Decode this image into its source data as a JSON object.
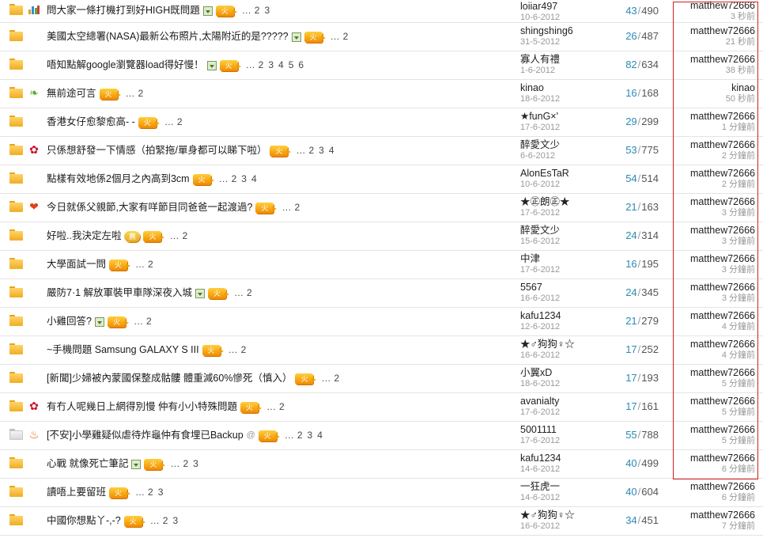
{
  "rows": [
    {
      "folder": "yellow",
      "emo": "chart-icon",
      "title": "問大家一條打機打到好HIGH既問題",
      "img": true,
      "clip": false,
      "badges": [
        "火"
      ],
      "pages": [
        "2",
        "3"
      ],
      "author": "loiiar497",
      "date": "10-6-2012",
      "replies": "43",
      "views": "490",
      "last_user": "matthew72666",
      "last_time": "3 秒前"
    },
    {
      "folder": "yellow",
      "emo": "",
      "title": "美國太空總署(NASA)最新公布照片,太陽附近的是?????",
      "img": true,
      "clip": false,
      "badges": [
        "火"
      ],
      "pages": [
        "2"
      ],
      "author": "shingshing6",
      "date": "31-5-2012",
      "replies": "26",
      "views": "487",
      "last_user": "matthew72666",
      "last_time": "21 秒前"
    },
    {
      "folder": "yellow",
      "emo": "",
      "title": "唔知點解google瀏覽器load得好慢！",
      "img": true,
      "clip": false,
      "badges": [
        "火"
      ],
      "pages": [
        "2",
        "3",
        "4",
        "5",
        "6"
      ],
      "author": "寡人有禮",
      "date": "1-6-2012",
      "replies": "82",
      "views": "634",
      "last_user": "matthew72666",
      "last_time": "38 秒前"
    },
    {
      "folder": "yellow",
      "emo": "leaf-icon",
      "title": "無前途可言",
      "img": false,
      "clip": false,
      "badges": [
        "火"
      ],
      "pages": [
        "2"
      ],
      "author": "kinao",
      "date": "18-6-2012",
      "replies": "16",
      "views": "168",
      "last_user": "kinao",
      "last_time": "50 秒前"
    },
    {
      "folder": "yellow",
      "emo": "",
      "title": "香港女仔愈黎愈高- -",
      "img": false,
      "clip": false,
      "badges": [
        "火"
      ],
      "pages": [
        "2"
      ],
      "author": "★funG×'",
      "date": "17-6-2012",
      "replies": "29",
      "views": "299",
      "last_user": "matthew72666",
      "last_time": "1 分鐘前"
    },
    {
      "folder": "yellow",
      "emo": "rose-icon",
      "title": "只係想舒發一下情感（拍緊拖/單身都可以睇下啦）",
      "img": false,
      "clip": false,
      "badges": [
        "火"
      ],
      "pages": [
        "2",
        "3",
        "4"
      ],
      "author": "醉愛文少",
      "date": "6-6-2012",
      "replies": "53",
      "views": "775",
      "last_user": "matthew72666",
      "last_time": "2 分鐘前"
    },
    {
      "folder": "yellow",
      "emo": "",
      "title": "點樣有效地係2個月之內高到3cm",
      "img": false,
      "clip": false,
      "badges": [
        "火"
      ],
      "pages": [
        "2",
        "3",
        "4"
      ],
      "author": "AlonEsTaR",
      "date": "10-6-2012",
      "replies": "54",
      "views": "514",
      "last_user": "matthew72666",
      "last_time": "2 分鐘前"
    },
    {
      "folder": "yellow",
      "emo": "heart-icon",
      "title": "今日就係父親節,大家有咩節目同爸爸一起渡過?",
      "img": false,
      "clip": false,
      "badges": [
        "火"
      ],
      "pages": [
        "2"
      ],
      "author": "★㊣朗㊣★",
      "date": "17-6-2012",
      "replies": "21",
      "views": "163",
      "last_user": "matthew72666",
      "last_time": "3 分鐘前"
    },
    {
      "folder": "yellow",
      "emo": "",
      "title": "好啦..我決定左啦",
      "img": false,
      "clip": false,
      "badges": [
        "薦",
        "火"
      ],
      "pages": [
        "2"
      ],
      "author": "醉愛文少",
      "date": "15-6-2012",
      "replies": "24",
      "views": "314",
      "last_user": "matthew72666",
      "last_time": "3 分鐘前"
    },
    {
      "folder": "yellow",
      "emo": "",
      "title": "大學面試一問",
      "img": false,
      "clip": false,
      "badges": [
        "火"
      ],
      "pages": [
        "2"
      ],
      "author": "中津",
      "date": "17-6-2012",
      "replies": "16",
      "views": "195",
      "last_user": "matthew72666",
      "last_time": "3 分鐘前"
    },
    {
      "folder": "yellow",
      "emo": "",
      "title": "嚴防7·1 解放軍裝甲車隊深夜入城",
      "img": true,
      "clip": false,
      "badges": [
        "火"
      ],
      "pages": [
        "2"
      ],
      "author": "5567",
      "date": "16-6-2012",
      "replies": "24",
      "views": "345",
      "last_user": "matthew72666",
      "last_time": "3 分鐘前"
    },
    {
      "folder": "yellow",
      "emo": "",
      "title": "小雞回答?",
      "img": true,
      "clip": false,
      "badges": [
        "火"
      ],
      "pages": [
        "2"
      ],
      "author": "kafu1234",
      "date": "12-6-2012",
      "replies": "21",
      "views": "279",
      "last_user": "matthew72666",
      "last_time": "4 分鐘前"
    },
    {
      "folder": "yellow",
      "emo": "",
      "title": "~手機問題 Samsung GALAXY S III",
      "img": false,
      "clip": false,
      "badges": [
        "火"
      ],
      "pages": [
        "2"
      ],
      "author": "★♂狗狗♀☆",
      "date": "16-6-2012",
      "replies": "17",
      "views": "252",
      "last_user": "matthew72666",
      "last_time": "4 分鐘前"
    },
    {
      "folder": "yellow",
      "emo": "",
      "title": "[新聞]少婦被內蒙國保整成骷髏 體重減60%慘死（慎入）",
      "img": false,
      "clip": false,
      "badges": [
        "火"
      ],
      "pages": [
        "2"
      ],
      "author": "小翼xD",
      "date": "18-6-2012",
      "replies": "17",
      "views": "193",
      "last_user": "matthew72666",
      "last_time": "5 分鐘前"
    },
    {
      "folder": "yellow",
      "emo": "rose-icon",
      "title": "有冇人呢幾日上網得別慢 仲有小小特殊問題",
      "img": false,
      "clip": false,
      "badges": [
        "火"
      ],
      "pages": [
        "2"
      ],
      "author": "avanialty",
      "date": "17-6-2012",
      "replies": "17",
      "views": "161",
      "last_user": "matthew72666",
      "last_time": "5 分鐘前"
    },
    {
      "folder": "gray",
      "emo": "fire-icon",
      "title": "[不安]小學雞疑似虐待炸龜仲有食埋已Backup",
      "img": false,
      "clip": true,
      "badges": [
        "火"
      ],
      "pages": [
        "2",
        "3",
        "4"
      ],
      "author": "5001111",
      "date": "17-6-2012",
      "replies": "55",
      "views": "788",
      "last_user": "matthew72666",
      "last_time": "5 分鐘前"
    },
    {
      "folder": "yellow",
      "emo": "",
      "title": "心戰 就像死亡筆記",
      "img": true,
      "clip": false,
      "badges": [
        "火"
      ],
      "pages": [
        "2",
        "3"
      ],
      "author": "kafu1234",
      "date": "14-6-2012",
      "replies": "40",
      "views": "499",
      "last_user": "matthew72666",
      "last_time": "6 分鐘前"
    },
    {
      "folder": "yellow",
      "emo": "",
      "title": "讀唔上要留班",
      "img": false,
      "clip": false,
      "badges": [
        "火"
      ],
      "pages": [
        "2",
        "3"
      ],
      "author": "一狂虎一",
      "date": "14-6-2012",
      "replies": "40",
      "views": "604",
      "last_user": "matthew72666",
      "last_time": "6 分鐘前"
    },
    {
      "folder": "yellow",
      "emo": "",
      "title": "中國你想點丫-,-?",
      "img": false,
      "clip": false,
      "badges": [
        "火"
      ],
      "pages": [
        "2",
        "3"
      ],
      "author": "★♂狗狗♀☆",
      "date": "16-6-2012",
      "replies": "34",
      "views": "451",
      "last_user": "matthew72666",
      "last_time": "7 分鐘前"
    }
  ]
}
